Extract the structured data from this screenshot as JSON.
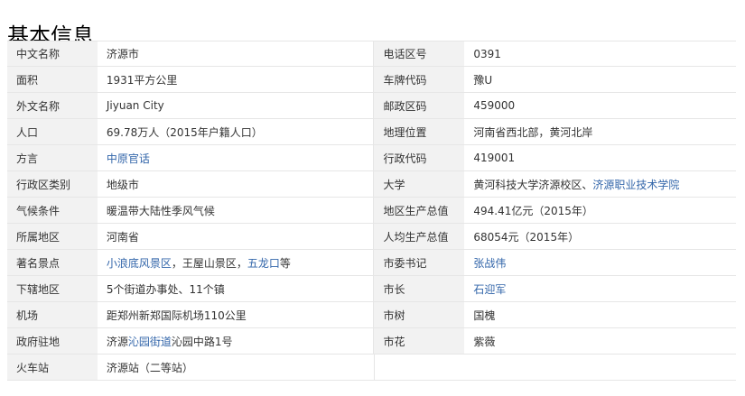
{
  "title": "基本信息",
  "rows": [
    {
      "k1": "中文名称",
      "v1": [
        {
          "t": "济源市",
          "l": false
        }
      ],
      "k2": "电话区号",
      "v2": [
        {
          "t": "0391",
          "l": false
        }
      ]
    },
    {
      "k1": "面积",
      "v1": [
        {
          "t": "1931平方公里",
          "l": false
        }
      ],
      "k2": "车牌代码",
      "v2": [
        {
          "t": "豫U",
          "l": false
        }
      ]
    },
    {
      "k1": "外文名称",
      "v1": [
        {
          "t": "Jiyuan City",
          "l": false
        }
      ],
      "k2": "邮政区码",
      "v2": [
        {
          "t": "459000",
          "l": false
        }
      ]
    },
    {
      "k1": "人口",
      "v1": [
        {
          "t": "69.78万人（2015年户籍人口）",
          "l": false
        }
      ],
      "k2": "地理位置",
      "v2": [
        {
          "t": "河南省西北部，黄河北岸",
          "l": false
        }
      ]
    },
    {
      "k1": "方言",
      "v1": [
        {
          "t": "中原官话",
          "l": true
        }
      ],
      "k2": "行政代码",
      "v2": [
        {
          "t": "419001",
          "l": false
        }
      ]
    },
    {
      "k1": "行政区类别",
      "v1": [
        {
          "t": "地级市",
          "l": false
        }
      ],
      "k2": "大学",
      "v2": [
        {
          "t": "黄河科技大学济源校区、",
          "l": false
        },
        {
          "t": "济源职业技术学院",
          "l": true
        }
      ]
    },
    {
      "k1": "气候条件",
      "v1": [
        {
          "t": "暖温带大陆性季风气候",
          "l": false
        }
      ],
      "k2": "地区生产总值",
      "v2": [
        {
          "t": "494.41亿元（2015年）",
          "l": false
        }
      ]
    },
    {
      "k1": "所属地区",
      "v1": [
        {
          "t": "河南省",
          "l": false
        }
      ],
      "k2": "人均生产总值",
      "v2": [
        {
          "t": "68054元（2015年）",
          "l": false
        }
      ]
    },
    {
      "k1": "著名景点",
      "v1": [
        {
          "t": "小浪底风景区",
          "l": true
        },
        {
          "t": "，王屋山景区，",
          "l": false
        },
        {
          "t": "五龙口",
          "l": true
        },
        {
          "t": "等",
          "l": false
        }
      ],
      "k2": "市委书记",
      "v2": [
        {
          "t": "张战伟",
          "l": true
        }
      ]
    },
    {
      "k1": "下辖地区",
      "v1": [
        {
          "t": "5个街道办事处、11个镇",
          "l": false
        }
      ],
      "k2": "市长",
      "v2": [
        {
          "t": "石迎军",
          "l": true
        }
      ]
    },
    {
      "k1": "机场",
      "v1": [
        {
          "t": "距郑州新郑国际机场110公里",
          "l": false
        }
      ],
      "k2": "市树",
      "v2": [
        {
          "t": "国槐",
          "l": false
        }
      ]
    },
    {
      "k1": "政府驻地",
      "v1": [
        {
          "t": "济源",
          "l": false
        },
        {
          "t": "沁园街道",
          "l": true
        },
        {
          "t": "沁园中路1号",
          "l": false
        }
      ],
      "k2": "市花",
      "v2": [
        {
          "t": "紫薇",
          "l": false
        }
      ]
    },
    {
      "k1": "火车站",
      "v1": [
        {
          "t": "济源站（二等站）",
          "l": false
        }
      ],
      "k2": "",
      "v2": []
    }
  ],
  "colors": {
    "link": "#3366aa",
    "key_bg": "#f2f2f2",
    "border": "#e6e6e6"
  }
}
